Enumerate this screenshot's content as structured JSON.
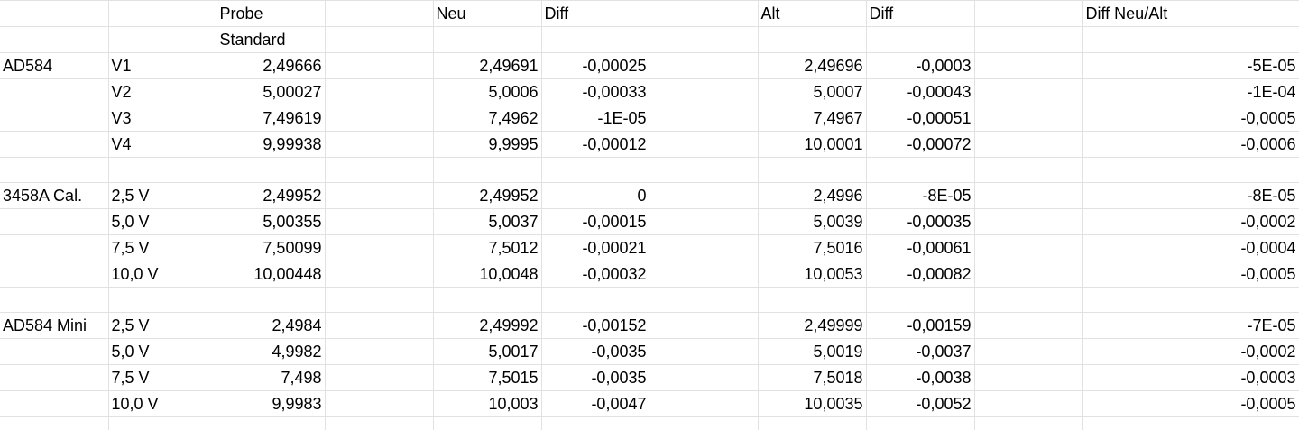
{
  "colors": {
    "text": "#000000",
    "diff": "#00b050",
    "gridline": "#e1e1e1"
  },
  "rows": [
    [
      "",
      "",
      "Probe",
      "",
      "Neu",
      "Diff",
      "",
      "Alt",
      "Diff",
      "",
      "Diff Neu/Alt"
    ],
    [
      "",
      "",
      "Standard",
      "",
      "",
      "",
      "",
      "",
      "",
      "",
      ""
    ],
    [
      "AD584",
      "V1",
      "2,49666",
      "",
      "2,49691",
      "-0,00025",
      "",
      "2,49696",
      "-0,0003",
      "",
      "-5E-05"
    ],
    [
      "",
      "V2",
      "5,00027",
      "",
      "5,0006",
      "-0,00033",
      "",
      "5,0007",
      "-0,00043",
      "",
      "-1E-04"
    ],
    [
      "",
      "V3",
      "7,49619",
      "",
      "7,4962",
      "-1E-05",
      "",
      "7,4967",
      "-0,00051",
      "",
      "-0,0005"
    ],
    [
      "",
      "V4",
      "9,99938",
      "",
      "9,9995",
      "-0,00012",
      "",
      "10,0001",
      "-0,00072",
      "",
      "-0,0006"
    ],
    [
      "",
      "",
      "",
      "",
      "",
      "",
      "",
      "",
      "",
      "",
      ""
    ],
    [
      "3458A Cal.",
      "2,5 V",
      "2,49952",
      "",
      "2,49952",
      "0",
      "",
      "2,4996",
      "-8E-05",
      "",
      "-8E-05"
    ],
    [
      "",
      "5,0 V",
      "5,00355",
      "",
      "5,0037",
      "-0,00015",
      "",
      "5,0039",
      "-0,00035",
      "",
      "-0,0002"
    ],
    [
      "",
      "7,5 V",
      "7,50099",
      "",
      "7,5012",
      "-0,00021",
      "",
      "7,5016",
      "-0,00061",
      "",
      "-0,0004"
    ],
    [
      "",
      "10,0 V",
      "10,00448",
      "",
      "10,0048",
      "-0,00032",
      "",
      "10,0053",
      "-0,00082",
      "",
      "-0,0005"
    ],
    [
      "",
      "",
      "",
      "",
      "",
      "",
      "",
      "",
      "",
      "",
      ""
    ],
    [
      "AD584 Mini",
      "2,5 V",
      "2,4984",
      "",
      "2,49992",
      "-0,00152",
      "",
      "2,49999",
      "-0,00159",
      "",
      "-7E-05"
    ],
    [
      "",
      "5,0 V",
      "4,9982",
      "",
      "5,0017",
      "-0,0035",
      "",
      "5,0019",
      "-0,0037",
      "",
      "-0,0002"
    ],
    [
      "",
      "7,5 V",
      "7,498",
      "",
      "7,5015",
      "-0,0035",
      "",
      "7,5018",
      "-0,0038",
      "",
      "-0,0003"
    ],
    [
      "",
      "10,0 V",
      "9,9983",
      "",
      "10,003",
      "-0,0047",
      "",
      "10,0035",
      "-0,0052",
      "",
      "-0,0005"
    ],
    [
      "",
      "",
      "",
      "",
      "",
      "",
      "",
      "",
      "",
      "",
      ""
    ]
  ]
}
